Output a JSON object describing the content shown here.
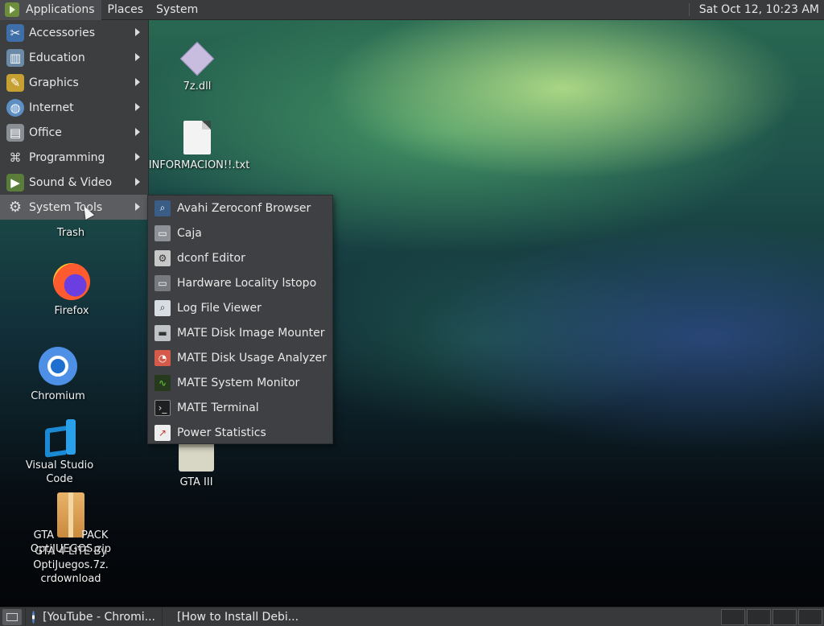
{
  "top_panel": {
    "menus": [
      "Applications",
      "Places",
      "System"
    ],
    "clock": "Sat Oct 12, 10:23 AM"
  },
  "app_menu": {
    "items": [
      {
        "label": "Accessories",
        "icon": "accessories-icon"
      },
      {
        "label": "Education",
        "icon": "education-icon"
      },
      {
        "label": "Graphics",
        "icon": "graphics-icon"
      },
      {
        "label": "Internet",
        "icon": "internet-icon"
      },
      {
        "label": "Office",
        "icon": "office-icon"
      },
      {
        "label": "Programming",
        "icon": "programming-icon"
      },
      {
        "label": "Sound & Video",
        "icon": "sound-video-icon"
      },
      {
        "label": "System Tools",
        "icon": "system-tools-icon",
        "active": true
      }
    ]
  },
  "system_tools_submenu": {
    "items": [
      {
        "label": "Avahi Zeroconf Browser",
        "icon": "avahi-icon"
      },
      {
        "label": "Caja",
        "icon": "caja-icon"
      },
      {
        "label": "dconf Editor",
        "icon": "dconf-icon"
      },
      {
        "label": "Hardware Locality lstopo",
        "icon": "lstopo-icon"
      },
      {
        "label": "Log File Viewer",
        "icon": "log-viewer-icon"
      },
      {
        "label": "MATE Disk Image Mounter",
        "icon": "disk-mounter-icon"
      },
      {
        "label": "MATE Disk Usage Analyzer",
        "icon": "disk-usage-icon"
      },
      {
        "label": "MATE System Monitor",
        "icon": "system-monitor-icon"
      },
      {
        "label": "MATE Terminal",
        "icon": "terminal-icon"
      },
      {
        "label": "Power Statistics",
        "icon": "power-stats-icon"
      }
    ]
  },
  "desktop": {
    "icons": {
      "dll": "7z.dll",
      "txt": "!INFORMACION!!.txt",
      "trash": "Trash",
      "firefox": "Firefox",
      "chromium": "Chromium",
      "vscode": "Visual Studio Code",
      "gta3": "GTA III",
      "gta_pack_line1": "GTA",
      "gta_pack_line1b": "PACK",
      "gta_pack_line2": "OptiJUEGOS.zip",
      "gta_pack_line2b": "GTA 4 LITE By",
      "gta_pack_line3": "OptiJuegos.7z.",
      "gta_pack_line4": "crdownload"
    }
  },
  "taskbar": {
    "tasks": [
      "[YouTube - Chromi...",
      "[How to Install Debi..."
    ]
  }
}
